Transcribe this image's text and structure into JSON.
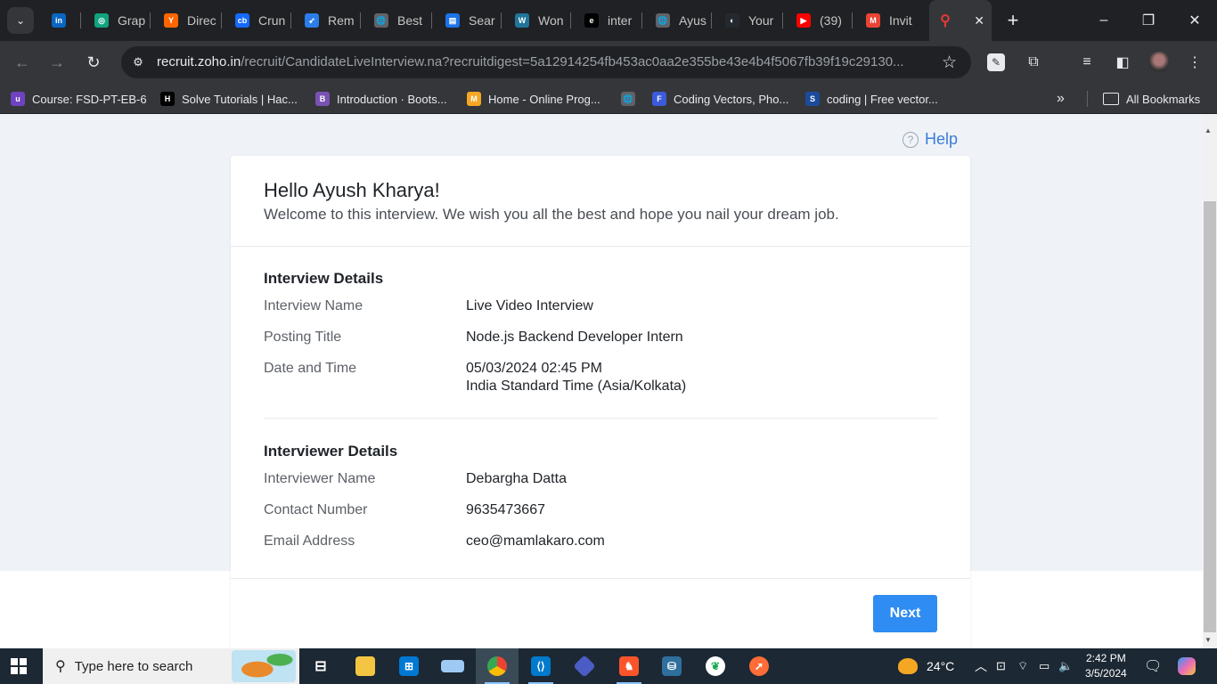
{
  "browser": {
    "tabs": [
      {
        "label": "",
        "fav": "in",
        "favColor": "#0a66c2"
      },
      {
        "label": "Grap",
        "fav": "◎",
        "favColor": "#10a37f"
      },
      {
        "label": "Direc",
        "fav": "Y",
        "favColor": "#ff6600"
      },
      {
        "label": "Crun",
        "fav": "cb",
        "favColor": "#146aff"
      },
      {
        "label": "Rem",
        "fav": "➶",
        "favColor": "#2b7de9"
      },
      {
        "label": "Best",
        "fav": "🌐",
        "favColor": "#5f6368"
      },
      {
        "label": "Sear",
        "fav": "▤",
        "favColor": "#1a73e8"
      },
      {
        "label": "Won",
        "fav": "W",
        "favColor": "#21759b"
      },
      {
        "label": "inter",
        "fav": "e",
        "favColor": "#000000"
      },
      {
        "label": "Ayus",
        "fav": "🌐",
        "favColor": "#5f6368"
      },
      {
        "label": "Your",
        "fav": "◐",
        "favColor": "#24292f"
      },
      {
        "label": "(39)",
        "fav": "▶",
        "favColor": "#ff0000"
      },
      {
        "label": "Invit",
        "fav": "M",
        "favColor": "#ea4335"
      }
    ],
    "active_tab_close": "✕",
    "new_tab": "+",
    "url_host": "recruit.zoho.in",
    "url_path": "/recruit/CandidateLiveInterview.na?recruitdigest=5a12914254fb453ac0aa2e355be43e4b4f5067fb39f19c29130..."
  },
  "bookmarks": [
    {
      "label": "Course: FSD-PT-EB-6",
      "fav": "u",
      "favColor": "#6f42c1"
    },
    {
      "label": "Solve Tutorials | Hac...",
      "fav": "H",
      "favColor": "#000000"
    },
    {
      "label": "Introduction · Boots...",
      "fav": "B",
      "favColor": "#7952b3"
    },
    {
      "label": "Home - Online Prog...",
      "fav": "M",
      "favColor": "#f5a623"
    },
    {
      "label": "",
      "fav": "🌐",
      "favColor": "#5f6368"
    },
    {
      "label": "Coding Vectors, Pho...",
      "fav": "F",
      "favColor": "#3b5bdb"
    },
    {
      "label": "coding | Free vector...",
      "fav": "S",
      "favColor": "#1c4b9c"
    }
  ],
  "bookmarks_more": "»",
  "all_bookmarks": "All Bookmarks",
  "page": {
    "help": "Help",
    "greeting": "Hello Ayush Kharya!",
    "welcome": "Welcome to this interview. We wish you all the best and hope you nail your dream job.",
    "interview_details": {
      "title": "Interview Details",
      "rows": [
        {
          "label": "Interview Name",
          "value": "Live Video Interview"
        },
        {
          "label": "Posting Title",
          "value": "Node.js Backend Developer Intern"
        },
        {
          "label": "Date and Time",
          "value": "05/03/2024 02:45 PM",
          "value2": "India Standard Time (Asia/Kolkata)"
        }
      ]
    },
    "interviewer_details": {
      "title": "Interviewer Details",
      "rows": [
        {
          "label": "Interviewer Name",
          "value": "Debargha Datta"
        },
        {
          "label": "Contact Number",
          "value": "9635473667"
        },
        {
          "label": "Email Address",
          "value": "ceo@mamlakaro.com"
        }
      ]
    },
    "next_button": "Next"
  },
  "taskbar": {
    "search_placeholder": "Type here to search",
    "temperature": "24°C",
    "time": "2:42 PM",
    "date": "3/5/2024"
  },
  "colors": {
    "accent": "#2f8cf2",
    "help": "#3a7dd6",
    "page_bg": "#eff3f8"
  }
}
